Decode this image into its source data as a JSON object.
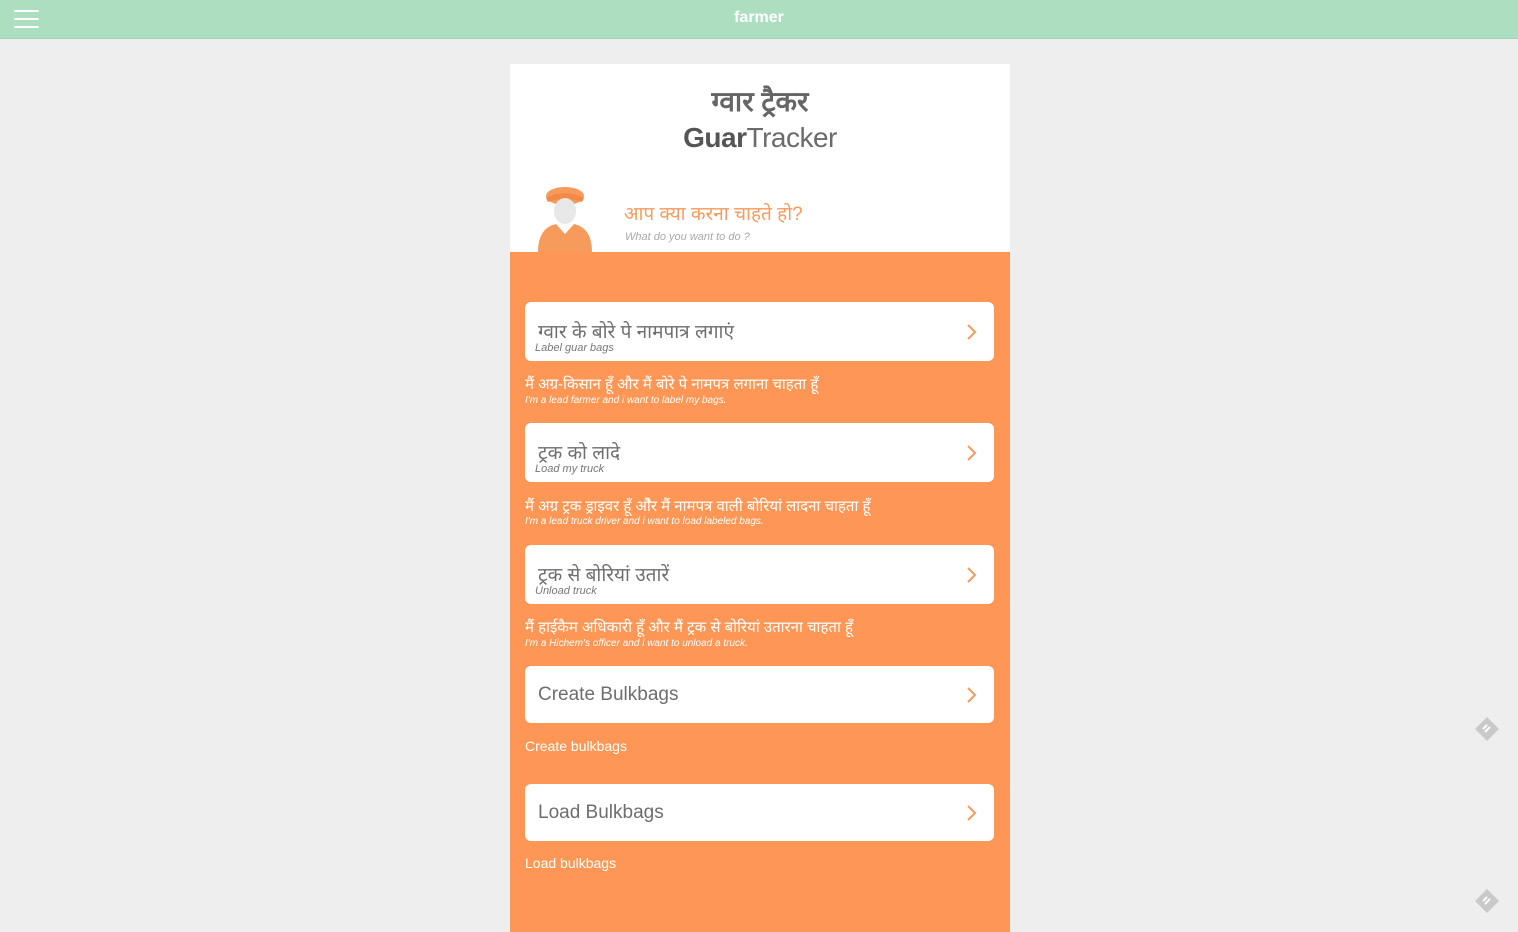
{
  "topbar": {
    "menu_icon": "hamburger-menu-icon",
    "title": "farmer"
  },
  "header": {
    "title_hindi": "ग्वार ट्रैकर",
    "title_en_bold": "Guar",
    "title_en_light": "Tracker"
  },
  "prompt": {
    "avatar_icon": "farmer-avatar-icon",
    "hindi": "आप क्या करना चाहते हो?",
    "english": "What do you want to do ?"
  },
  "options": [
    {
      "title": "ग्वार के बोरे पे नामपात्र लगाएं",
      "subtitle": "Label guar bags",
      "desc_hindi": "मैं अग्र-किसान हूँ और मैं बोरे पे नामपत्र लगाना चाहता हूँ",
      "desc_english": "I'm a lead farmer and i want to label my bags."
    },
    {
      "title": "ट्रक को लादे",
      "subtitle": "Load my truck",
      "desc_hindi": "मैं अग्र ट्रक ड्राइवर हूँ औेर मैं नामपत्र वाली बोरियां लादना चाहता हूँ",
      "desc_english": "I'm a lead truck driver and i want to load labeled bags."
    },
    {
      "title": "ट्रक से बोरियां उतारें",
      "subtitle": "Unload truck",
      "desc_hindi": "मैं हाईकैम अधिकारी हूँ और मैं ट्रक से बोरियां उतारना चाहता हूँ",
      "desc_english": "I'm a Hichem's officer and i want to unload a truck."
    },
    {
      "title": "Create Bulkbags",
      "desc": "Create bulkbags"
    },
    {
      "title": "Load Bulkbags",
      "desc": "Load bulkbags"
    }
  ],
  "colors": {
    "topbar": "#acdfc0",
    "accent_orange": "#fe9755",
    "background": "#eeeeee"
  },
  "icons": {
    "chevron": "chevron-right-icon",
    "feedback": "feedback-icon"
  }
}
